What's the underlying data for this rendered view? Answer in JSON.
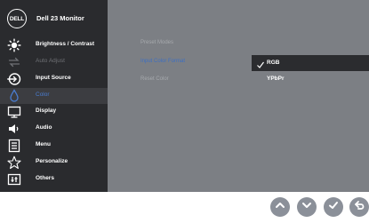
{
  "osd": {
    "brand": "DELL",
    "title": "Dell 23 Monitor",
    "menu": [
      {
        "label": "Brightness / Contrast",
        "icon": "sun-icon",
        "state": "normal"
      },
      {
        "label": "Auto Adjust",
        "icon": "auto-adjust-icon",
        "state": "disabled"
      },
      {
        "label": "Input Source",
        "icon": "input-source-icon",
        "state": "normal"
      },
      {
        "label": "Color",
        "icon": "color-drop-icon",
        "state": "selected"
      },
      {
        "label": "Display",
        "icon": "display-icon",
        "state": "normal"
      },
      {
        "label": "Audio",
        "icon": "speaker-icon",
        "state": "normal"
      },
      {
        "label": "Menu",
        "icon": "menu-list-icon",
        "state": "normal"
      },
      {
        "label": "Personalize",
        "icon": "star-icon",
        "state": "normal"
      },
      {
        "label": "Others",
        "icon": "others-icon",
        "state": "normal"
      }
    ],
    "submenu": [
      {
        "label": "Preset Modes",
        "state": "normal"
      },
      {
        "label": "Input Color Format",
        "state": "active"
      },
      {
        "label": "Reset Color",
        "state": "normal"
      }
    ],
    "options": [
      {
        "label": "RGB",
        "checked": true
      },
      {
        "label": "YPbPr",
        "checked": false
      }
    ]
  },
  "buttons": [
    {
      "icon": "chevron-up-icon"
    },
    {
      "icon": "chevron-down-icon"
    },
    {
      "icon": "checkmark-icon"
    },
    {
      "icon": "back-arrow-icon"
    }
  ],
  "colors": {
    "sidebar_bg": "#2a2b2e",
    "panel_bg": "#7c7f84",
    "accent_blue": "#3d6fc2",
    "button_gray": "#8b9099"
  }
}
